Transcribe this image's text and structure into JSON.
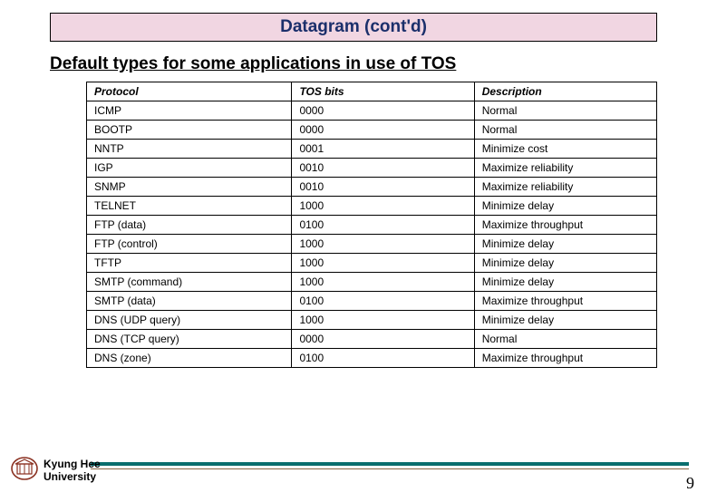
{
  "header": {
    "title": "Datagram (cont'd)"
  },
  "subtitle": "Default types for some applications in use of TOS",
  "table": {
    "headers": [
      "Protocol",
      "TOS bits",
      "Description"
    ],
    "rows": [
      {
        "protocol": "ICMP",
        "tos": "0000",
        "desc": "Normal"
      },
      {
        "protocol": "BOOTP",
        "tos": "0000",
        "desc": "Normal"
      },
      {
        "protocol": "NNTP",
        "tos": "0001",
        "desc": "Minimize cost"
      },
      {
        "protocol": "IGP",
        "tos": "0010",
        "desc": "Maximize reliability"
      },
      {
        "protocol": "SNMP",
        "tos": "0010",
        "desc": "Maximize reliability"
      },
      {
        "protocol": "TELNET",
        "tos": "1000",
        "desc": "Minimize delay"
      },
      {
        "protocol": "FTP (data)",
        "tos": "0100",
        "desc": "Maximize throughput"
      },
      {
        "protocol": "FTP (control)",
        "tos": "1000",
        "desc": "Minimize delay"
      },
      {
        "protocol": "TFTP",
        "tos": "1000",
        "desc": "Minimize delay"
      },
      {
        "protocol": "SMTP (command)",
        "tos": "1000",
        "desc": "Minimize delay"
      },
      {
        "protocol": "SMTP (data)",
        "tos": "0100",
        "desc": "Maximize throughput"
      },
      {
        "protocol": "DNS (UDP query)",
        "tos": "1000",
        "desc": "Minimize delay"
      },
      {
        "protocol": "DNS (TCP query)",
        "tos": "0000",
        "desc": "Normal"
      },
      {
        "protocol": "DNS (zone)",
        "tos": "0100",
        "desc": "Maximize throughput"
      }
    ]
  },
  "footer": {
    "university_line1": "Kyung Hee",
    "university_line2": "University",
    "page_number": "9"
  }
}
